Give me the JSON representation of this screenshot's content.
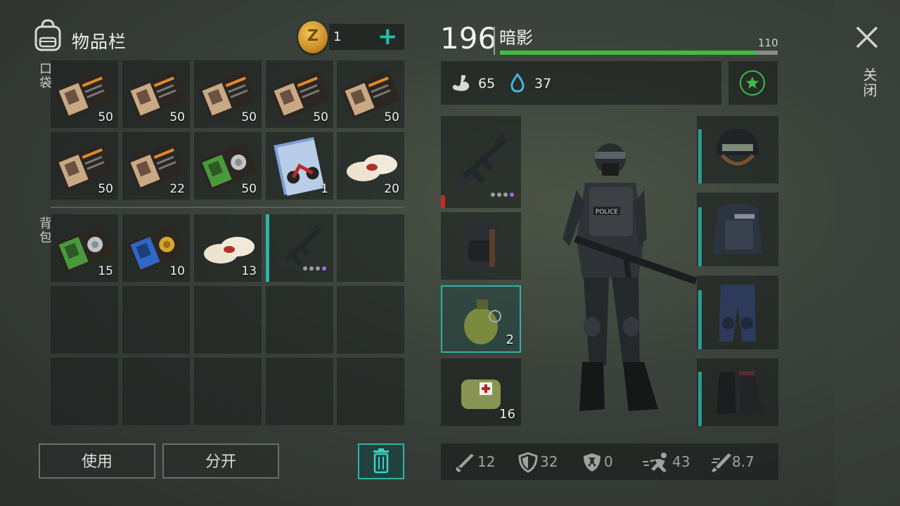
{
  "inventory": {
    "title": "物品栏",
    "coins": "1",
    "add_symbol": "+",
    "pockets_label": "口袋",
    "backpack_label": "背包",
    "pockets": [
      {
        "icon": "patrol-officer-id-icon",
        "count": "50"
      },
      {
        "icon": "patrol-officer-id-icon",
        "count": "50"
      },
      {
        "icon": "patrol-officer-id-icon",
        "count": "50"
      },
      {
        "icon": "patrol-officer-id-icon",
        "count": "50"
      },
      {
        "icon": "patrol-officer-id-icon",
        "count": "50"
      },
      {
        "icon": "patrol-officer-id-icon",
        "count": "50"
      },
      {
        "icon": "patrol-officer-id-icon",
        "count": "22"
      },
      {
        "icon": "green-police-badge-icon",
        "count": "50"
      },
      {
        "icon": "blueprint-motorcycle-icon",
        "count": "1"
      },
      {
        "icon": "bandage-icon",
        "count": "20"
      }
    ],
    "backpack": [
      {
        "icon": "green-police-badge-icon",
        "count": "15"
      },
      {
        "icon": "blue-police-badge-icon",
        "count": "10"
      },
      {
        "icon": "bandage-icon",
        "count": "13"
      },
      {
        "icon": "assault-rifle-icon",
        "count": ""
      }
    ],
    "buttons": {
      "use": "使用",
      "split": "分开"
    }
  },
  "character": {
    "level": "196",
    "name": "暗影",
    "xp_value": "110",
    "xp_fraction": 0.92,
    "food": "65",
    "water": "37",
    "weapon_slots": [
      {
        "icon": "assault-rifle-icon",
        "count": ""
      },
      {
        "icon": "backpack-icon",
        "count": ""
      },
      {
        "icon": "grenade-icon",
        "count": "2"
      },
      {
        "icon": "medkit-bag-icon",
        "count": "16"
      }
    ],
    "armor_slots": [
      {
        "icon": "helmet-icon"
      },
      {
        "icon": "police-vest-icon"
      },
      {
        "icon": "pants-icon"
      },
      {
        "icon": "boots-icon"
      }
    ],
    "stats": {
      "attack": "12",
      "armor": "32",
      "radiation": "0",
      "speed": "43",
      "gather": "8.7"
    }
  },
  "close_label": "关闭",
  "colors": {
    "accent": "#2fb3a8",
    "xp": "#3fbd3f",
    "rarity": "#a36be0"
  }
}
